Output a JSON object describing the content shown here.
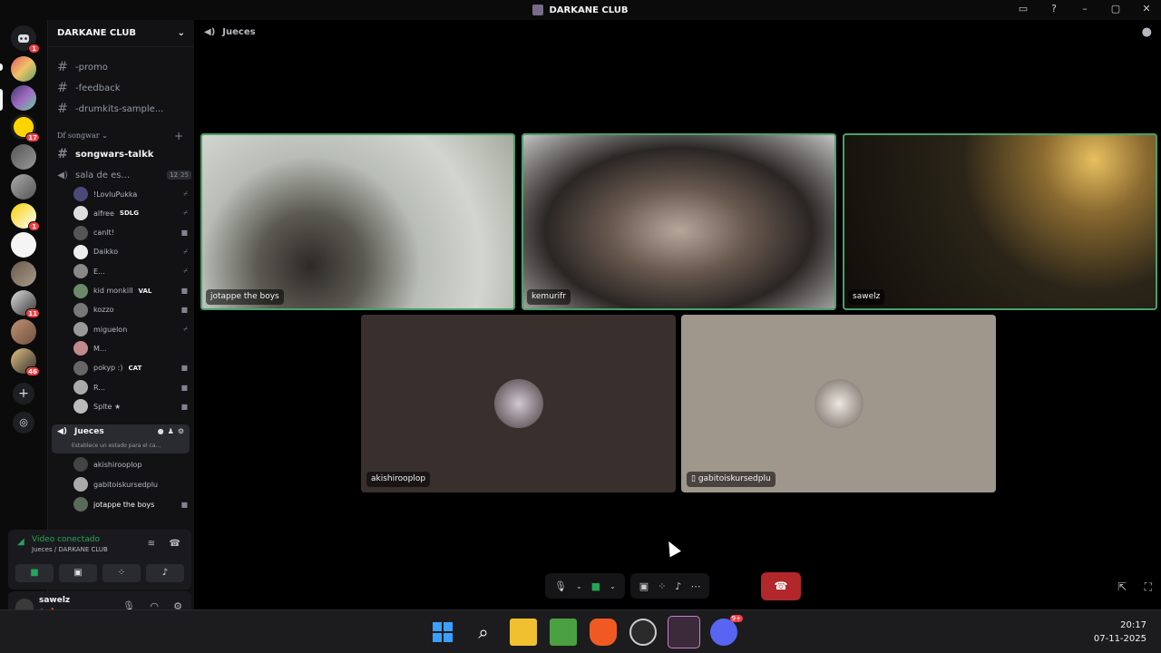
{
  "window": {
    "title": "DARKANE CLUB"
  },
  "guild": {
    "name": "DARKANE CLUB"
  },
  "channels": [
    {
      "name": "-promo"
    },
    {
      "name": "-feedback"
    },
    {
      "name": "-drumkits-sample..."
    }
  ],
  "category": "Df songwar",
  "songwars_channel": "songwars-talkk",
  "voice_channel_1": {
    "name": "sala de es...",
    "count_a": "12",
    "count_b": "25"
  },
  "members_1": [
    "!LovluPukka",
    "alfree",
    "canlt!",
    "Daikko",
    "E...",
    "kid monkill",
    "kozzo",
    "miguelon",
    "M...",
    "pokyp :)",
    "R...",
    "Splte ★"
  ],
  "member_tags": {
    "alfree": "SDLG",
    "kid monkill": "VAL",
    "pokyp :)": "CAT"
  },
  "voice_channel_2": {
    "name": "Jueces",
    "status": "Establece un estado para el ca..."
  },
  "members_2": [
    "akishirooplop",
    "gabitoiskursedplu",
    "jotappe the boys"
  ],
  "voice_panel": {
    "status": "Video conectado",
    "location": "Jueces / DARKANE CLUB"
  },
  "user": {
    "name": "sawelz"
  },
  "main": {
    "channel": "Jueces"
  },
  "tiles": [
    {
      "name": "jotappe the boys"
    },
    {
      "name": "kemurifr"
    },
    {
      "name": "sawelz"
    },
    {
      "name": "akishirooplop"
    },
    {
      "name": "gabitoiskursedplu"
    }
  ],
  "badges": {
    "b1": "1",
    "b2": "17",
    "b3": "1",
    "b4": "11",
    "b5": "46",
    "discord": "9+"
  },
  "clock": {
    "time": "20:17",
    "date": "07-11-2025"
  },
  "colors": {
    "speaking": "#4ba06a",
    "hangup": "#b1272a",
    "connected": "#23a55a"
  }
}
